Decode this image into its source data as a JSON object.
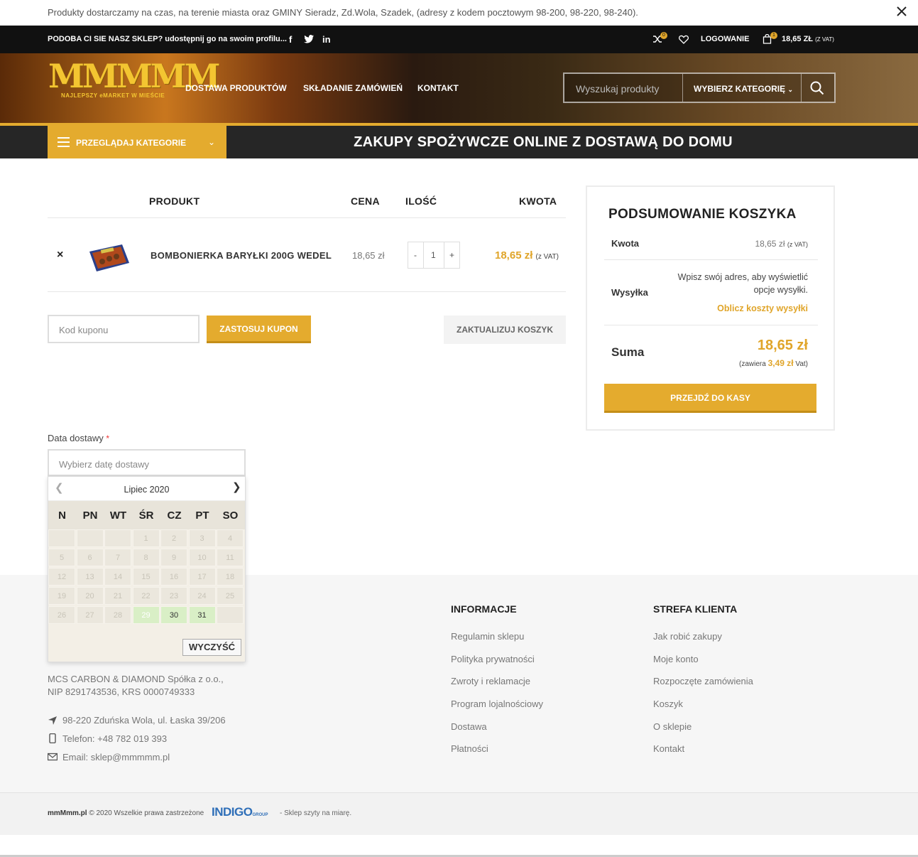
{
  "notice": {
    "text": "Produkty dostarczamy na czas, na terenie miasta oraz GMINY Sieradz, Zd.Wola, Szadek, (adresy z kodem pocztowym 98-200, 98-220, 98-240)."
  },
  "topbar": {
    "share_text": "PODOBA CI SIE NASZ SKLEP? udostępnij go na swoim profilu...",
    "compare_count": "0",
    "login_label": "LOGOWANIE",
    "cart_count": "1",
    "cart_total": "18,65 ZŁ",
    "cart_vat": "(Z VAT)"
  },
  "header": {
    "logo_text": "MMMMM",
    "logo_tagline": "NAJLEPSZY eMARKET W MIEŚCIE",
    "nav": [
      "DOSTAWA PRODUKTÓW",
      "SKŁADANIE ZAMÓWIEŃ",
      "KONTAKT"
    ],
    "search_placeholder": "Wyszukaj produkty",
    "category_select": "WYBIERZ KATEGORIĘ"
  },
  "catbar": {
    "browse_label": "PRZEGLĄDAJ KATEGORIE",
    "promo": "ZAKUPY SPOŻYWCZE ONLINE Z DOSTAWĄ DO DOMU"
  },
  "cart": {
    "headers": {
      "product": "PRODUKT",
      "price": "CENA",
      "qty": "ILOŚĆ",
      "amount": "KWOTA"
    },
    "items": [
      {
        "name": "BOMBONIERKA BARYŁKI 200G WEDEL",
        "price": "18,65 zł",
        "qty": "1",
        "amount": "18,65 zł",
        "amount_vat": "(z VAT)"
      }
    ],
    "qty_minus": "-",
    "qty_plus": "+",
    "remove": "×",
    "coupon_placeholder": "Kod kuponu",
    "apply_coupon": "ZASTOSUJ KUPON",
    "update_cart": "ZAKTUALIZUJ KOSZYK"
  },
  "summary": {
    "title": "PODSUMOWANIE KOSZYKA",
    "subtotal_label": "Kwota",
    "subtotal_value": "18,65 zł",
    "subtotal_vat": "(z VAT)",
    "shipping_label": "Wysyłka",
    "shipping_text": "Wpisz swój adres, aby wyświetlić opcje wysyłki.",
    "shipping_calc": "Oblicz koszty wysyłki",
    "total_label": "Suma",
    "total_value": "18,65 zł",
    "vat_prefix": "(zawiera",
    "vat_value": "3,49 zł",
    "vat_suffix": "Vat)",
    "checkout": "PRZEJDŹ DO KASY"
  },
  "delivery": {
    "label": "Data dostawy",
    "required": "*",
    "placeholder": "Wybierz datę dostawy",
    "calendar": {
      "month": "Lipiec 2020",
      "days_of_week": [
        "N",
        "PN",
        "WT",
        "ŚR",
        "CZ",
        "PT",
        "SO"
      ],
      "clear": "WYCZYŚĆ",
      "weeks": [
        [
          "",
          "",
          "",
          "1",
          "2",
          "3",
          "4"
        ],
        [
          "5",
          "6",
          "7",
          "8",
          "9",
          "10",
          "11"
        ],
        [
          "12",
          "13",
          "14",
          "15",
          "16",
          "17",
          "18"
        ],
        [
          "19",
          "20",
          "21",
          "22",
          "23",
          "24",
          "25"
        ],
        [
          "26",
          "27",
          "28",
          "29",
          "30",
          "31",
          ""
        ]
      ],
      "available": [
        "29",
        "30",
        "31"
      ]
    }
  },
  "footer": {
    "company": "MCS CARBON & DIAMOND Spółka z o.o.,",
    "company2": "NIP 8291743536, KRS 0000749333",
    "address": "98-220 Zduńska Wola, ul. Łaska 39/206",
    "phone": "Telefon: +48 782 019 393",
    "email": "Email: sklep@mmmmm.pl",
    "col1_title": "INFORMACJE",
    "col1": [
      "Regulamin sklepu",
      "Polityka prywatności",
      "Zwroty i reklamacje",
      "Program lojalnościowy",
      "Dostawa",
      "Płatności"
    ],
    "col2_title": "STREFA KLIENTA",
    "col2": [
      "Jak robić zakupy",
      "Moje konto",
      "Rozpoczęte zamówienia",
      "Koszyk",
      "O sklepie",
      "Kontakt"
    ]
  },
  "copyright": {
    "site": "mmMmm.pl",
    "text": "2020 Wszelkie prawa zastrzeżone",
    "brand": "INDIGO",
    "brand_sub": "GROUP",
    "tagline": "- Sklep szyty na miarę."
  },
  "colors": {
    "accent": "#e4ab2e",
    "dark": "#111111",
    "available_day": "#d9efc6"
  }
}
